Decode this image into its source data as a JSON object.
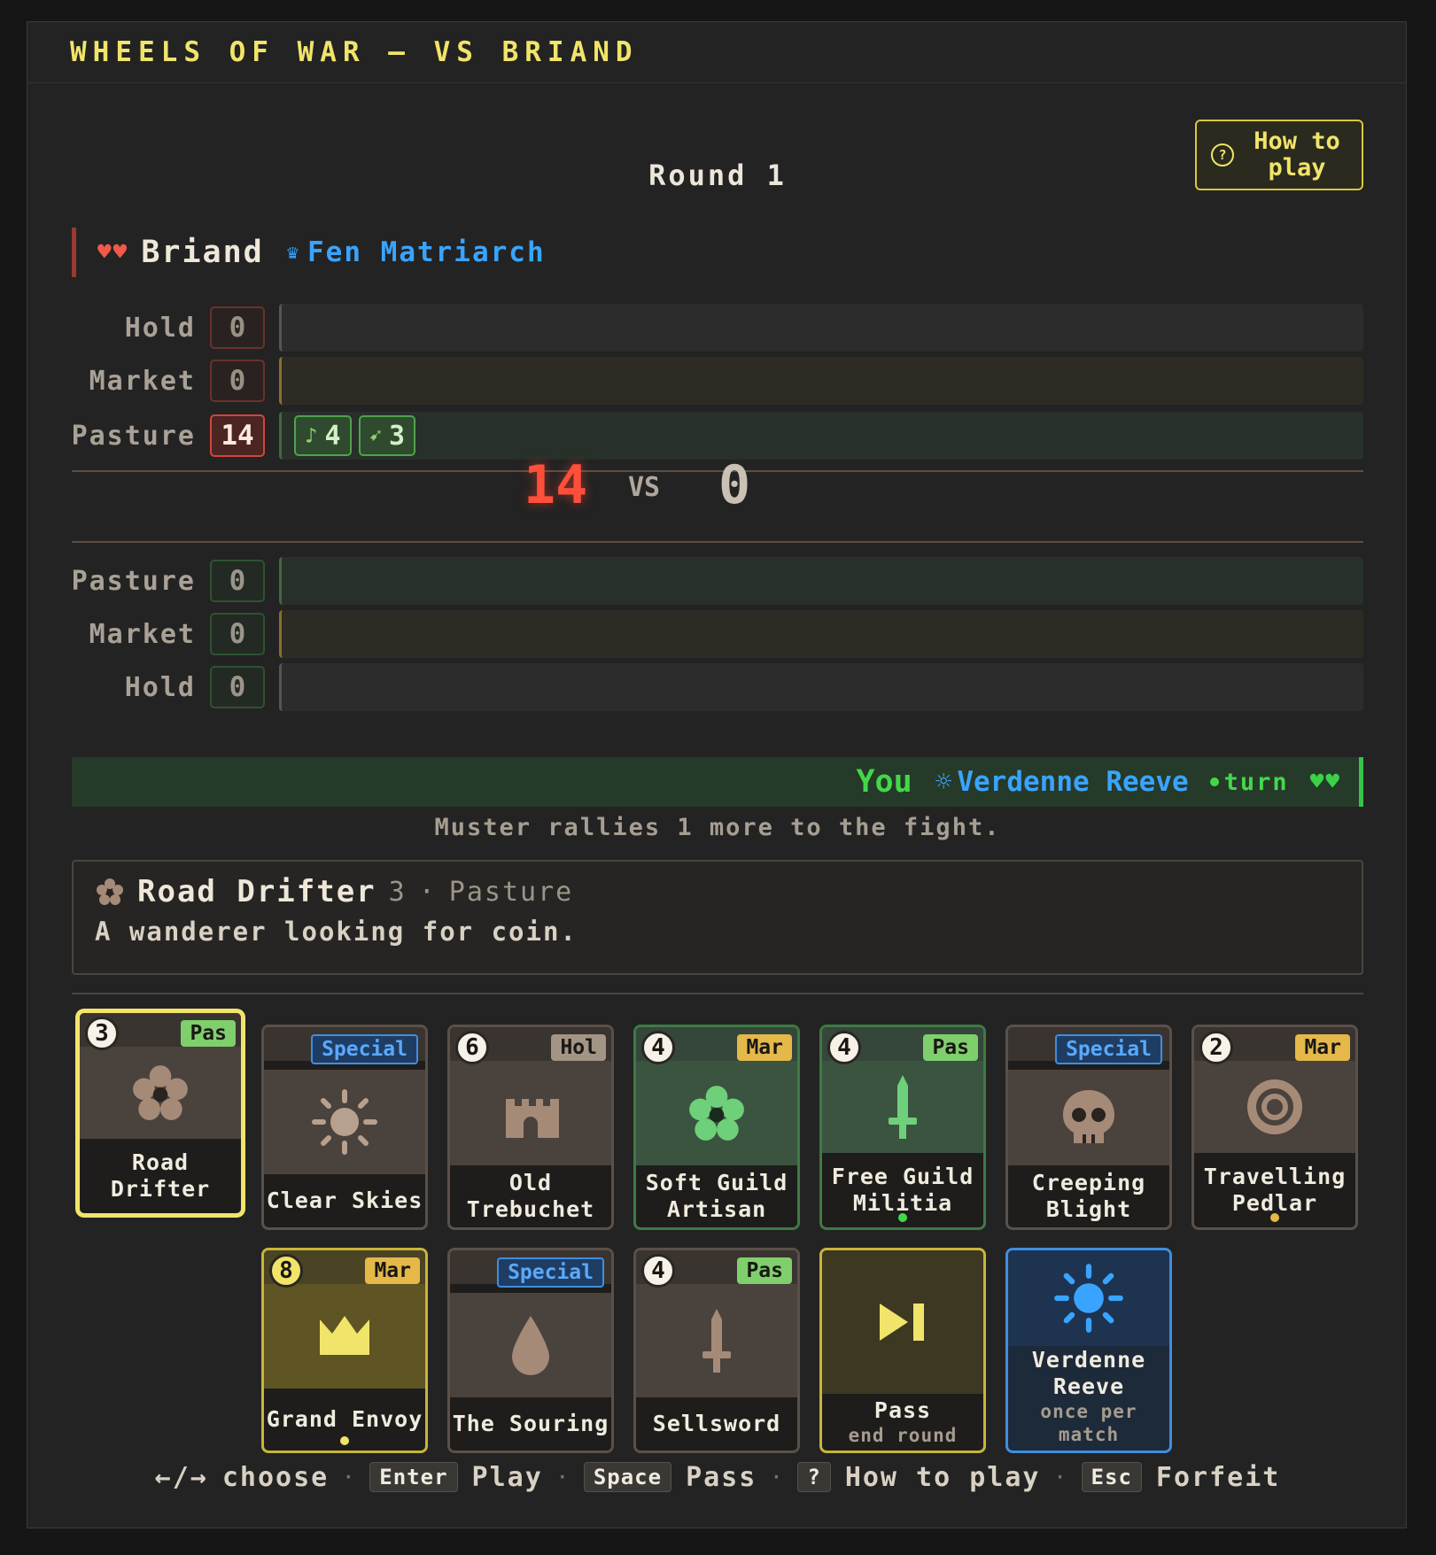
{
  "window_title": "WHEELS OF WAR — VS BRIAND",
  "round_label": "Round 1",
  "howto_button": "How to\nplay",
  "opponent": {
    "hearts": "♥♥",
    "name": "Briand",
    "leader": "Fen Matriarch",
    "rows": [
      {
        "label": "Hold",
        "count": "0"
      },
      {
        "label": "Market",
        "count": "0"
      },
      {
        "label": "Pasture",
        "count": "14",
        "chips": [
          {
            "icon": "music-note-icon",
            "glyph": "♪",
            "value": "4"
          },
          {
            "icon": "bow-icon",
            "glyph": "➹",
            "value": "3"
          }
        ]
      }
    ]
  },
  "score": {
    "opponent": "14",
    "vs": "VS",
    "player": "0"
  },
  "player": {
    "rows": [
      {
        "label": "Pasture",
        "count": "0"
      },
      {
        "label": "Market",
        "count": "0"
      },
      {
        "label": "Hold",
        "count": "0"
      }
    ],
    "you_label": "You",
    "leader": "Verdenne Reeve",
    "turn_label": "turn",
    "hearts": "♥♥"
  },
  "message": "Muster rallies 1 more to the fight.",
  "detail": {
    "icon": "flower-cluster-icon",
    "name": "Road Drifter",
    "power": "3",
    "separator": "·",
    "lane": "Pasture",
    "description": "A wanderer looking for coin."
  },
  "hand": [
    {
      "name": "Road Drifter",
      "power": "3",
      "tag": "Pas",
      "icon": "flower-cluster-icon",
      "selected": true
    },
    {
      "name": "Clear Skies",
      "tag": "Special",
      "icon": "sun-icon"
    },
    {
      "name": "Old Trebuchet",
      "power": "6",
      "tag": "Hol",
      "icon": "castle-icon"
    },
    {
      "name": "Soft Guild Artisan",
      "power": "4",
      "tag": "Mar",
      "icon": "flower-cluster-icon"
    },
    {
      "name": "Free Guild Militia",
      "power": "4",
      "tag": "Pas",
      "icon": "sword-icon",
      "dot": "green"
    },
    {
      "name": "Creeping Blight",
      "tag": "Special",
      "icon": "skull-icon"
    },
    {
      "name": "Travelling Pedlar",
      "power": "2",
      "tag": "Mar",
      "icon": "ring-icon",
      "dot": "gold"
    },
    {
      "name": "Grand Envoy",
      "power": "8",
      "tag": "Mar",
      "icon": "crown-icon",
      "dot": "gold"
    },
    {
      "name": "The Souring",
      "tag": "Special",
      "icon": "drop-icon"
    },
    {
      "name": "Sellsword",
      "power": "4",
      "tag": "Pas",
      "icon": "sword-icon"
    },
    {
      "name": "Pass",
      "sub": "end round",
      "icon": "skip-icon"
    },
    {
      "name": "Verdenne Reeve",
      "sub": "once per match",
      "icon": "sun-icon"
    }
  ],
  "footer": {
    "choose_keys": "←/→",
    "choose": "choose",
    "play_key": "Enter",
    "play": "Play",
    "pass_key": "Space",
    "pass": "Pass",
    "howto_key": "?",
    "howto": "How to play",
    "forfeit_key": "Esc",
    "forfeit": "Forfeit",
    "sep": "·"
  },
  "colors": {
    "accent": "#f1e46a",
    "opponent": "#f15a48",
    "player": "#43d84a",
    "leader": "#39a4ff"
  }
}
